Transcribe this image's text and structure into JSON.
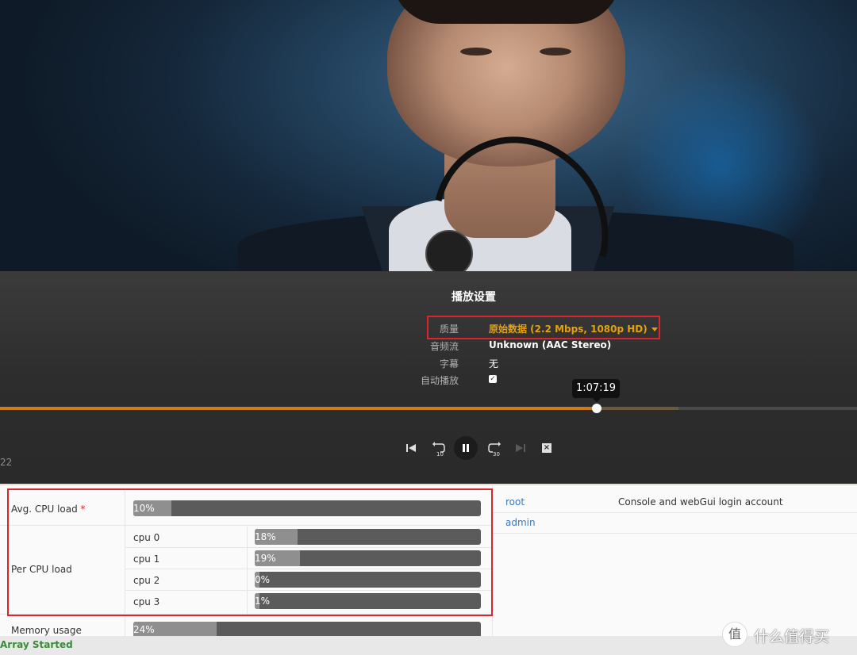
{
  "player": {
    "settings_title": "播放设置",
    "settings": {
      "quality_label": "质量",
      "quality_value": "原始数据 (2.2 Mbps, 1080p HD)",
      "audio_label": "音频流",
      "audio_value": "Unknown (AAC Stereo)",
      "subtitle_label": "字幕",
      "subtitle_value": "无",
      "autoplay_label": "自动播放",
      "autoplay_checked": true
    },
    "time_tooltip": "1:07:19",
    "progress_fraction": 0.696,
    "buffer_fraction": 0.792,
    "controls": [
      "previous-icon",
      "replay-10-icon",
      "pause-icon",
      "forward-30-icon",
      "next-icon",
      "stop-icon"
    ],
    "replay_label": "10",
    "forward_label": "30",
    "stop_glyph": "×",
    "panel_number": "22",
    "accent_color": "#cc7b19",
    "quality_color": "#e5a00d"
  },
  "dashboard": {
    "avg_cpu": {
      "label": "Avg. CPU load",
      "required_mark": "*",
      "value_text": "10%",
      "value": 10
    },
    "per_cpu": {
      "label": "Per CPU load",
      "cpus": [
        {
          "name": "cpu 0",
          "value_text": "18%",
          "value": 18
        },
        {
          "name": "cpu 1",
          "value_text": "19%",
          "value": 19
        },
        {
          "name": "cpu 2",
          "value_text": "0%",
          "value": 0
        },
        {
          "name": "cpu 3",
          "value_text": "1%",
          "value": 1
        }
      ]
    },
    "memory": {
      "label": "Memory usage",
      "value_text": "24%",
      "value": 24
    },
    "users": [
      {
        "name": "root",
        "description": "Console and webGui login account"
      },
      {
        "name": "admin",
        "description": ""
      }
    ],
    "status": "Array Started",
    "status_color": "#3a8b3a"
  },
  "watermark": {
    "icon_glyph": "值",
    "text": "什么值得买"
  },
  "highlight_color": "#d9262e"
}
